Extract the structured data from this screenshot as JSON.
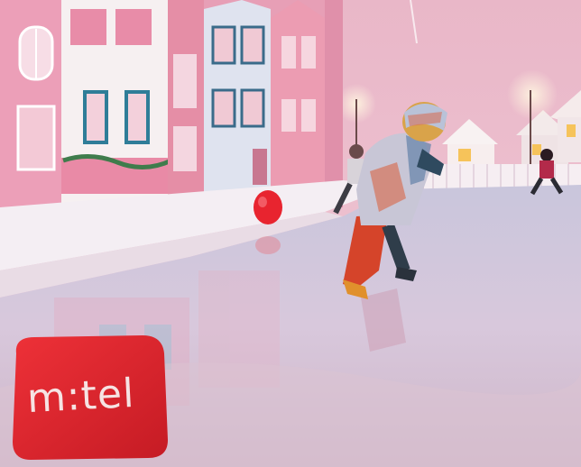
{
  "scene": {
    "description_free": true,
    "brand_sign": {
      "text": "m:tel",
      "color": "#e0232a",
      "text_color": "#f6e3e3"
    },
    "palette": {
      "wall_pink": "#e9a7bd",
      "ice": "#d9c9dd",
      "snow": "#f4eef3",
      "balloon": "#e8242f",
      "window_frame": "#2f7d98"
    }
  }
}
